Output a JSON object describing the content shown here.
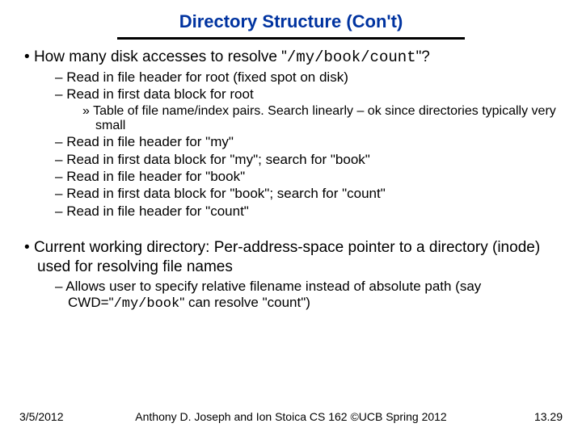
{
  "title": "Directory Structure (Con't)",
  "q_pre": "How many disk accesses to resolve \"",
  "q_path": "/my/book/count",
  "q_post": "\"?",
  "b1": "Read in file header for root (fixed spot on disk)",
  "b2": "Read in first data block for root",
  "b2a": "Table of file name/index pairs.  Search linearly – ok since directories typically very small",
  "b3": "Read in file header for \"my\"",
  "b4": "Read in first data block for \"my\"; search for \"book\"",
  "b5": "Read in file header for \"book\"",
  "b6": "Read in first data block for \"book\"; search for \"count\"",
  "b7": "Read in file header for \"count\"",
  "cwd_pre": "Current working directory: Per-address-space pointer to a directory (inode) used for resolving file names",
  "cwd_sub_a": "Allows user to specify relative filename instead of absolute path (say CWD=\"",
  "cwd_sub_path": "/my/book",
  "cwd_sub_b": "\" can resolve \"count\")",
  "footer_date": "3/5/2012",
  "footer_center": "Anthony D. Joseph and Ion Stoica  CS 162 ©UCB Spring 2012",
  "footer_page": "13.29"
}
